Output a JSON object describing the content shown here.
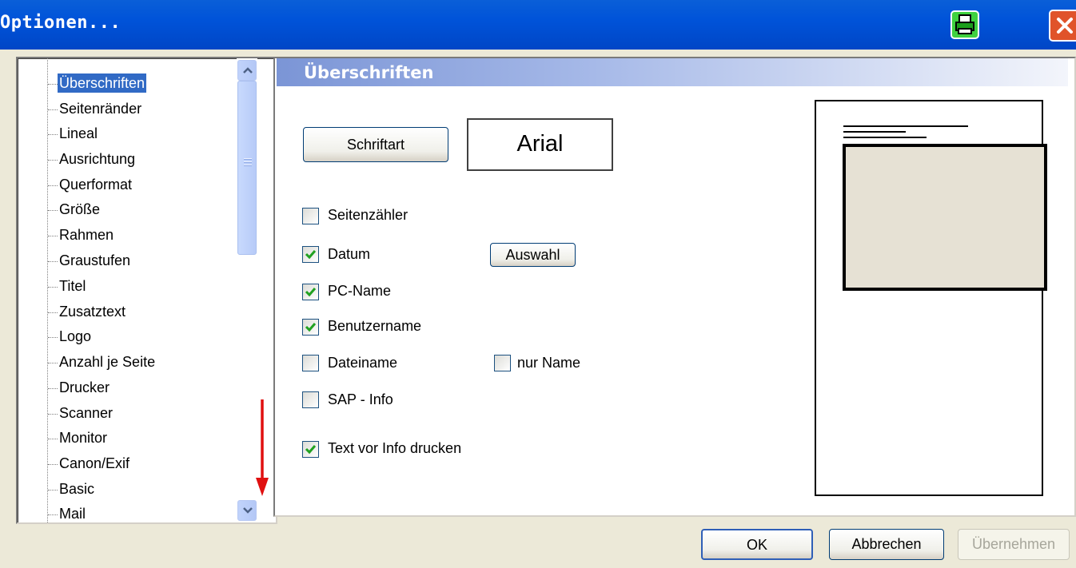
{
  "window": {
    "title": "Optionen...",
    "colors": {
      "titlebar": "#0053d9",
      "close": "#e0532a",
      "print_button": "#3fd13f"
    },
    "icons": {
      "print": "printer-icon",
      "close": "close-icon"
    }
  },
  "tree": {
    "selected": "Überschriften",
    "items": [
      {
        "label": "Überschriften"
      },
      {
        "label": "Seitenränder"
      },
      {
        "label": "Lineal"
      },
      {
        "label": "Ausrichtung"
      },
      {
        "label": "Querformat"
      },
      {
        "label": "Größe"
      },
      {
        "label": "Rahmen"
      },
      {
        "label": "Graustufen"
      },
      {
        "label": "Titel"
      },
      {
        "label": "Zusatztext"
      },
      {
        "label": "Logo"
      },
      {
        "label": "Anzahl je Seite"
      },
      {
        "label": "Drucker"
      },
      {
        "label": "Scanner"
      },
      {
        "label": "Monitor"
      },
      {
        "label": "Canon/Exif"
      },
      {
        "label": "Basic"
      },
      {
        "label": "Mail"
      }
    ]
  },
  "panel": {
    "title": "Überschriften",
    "font_button": "Schriftart",
    "font_name": "Arial",
    "select_button": "Auswahl",
    "options": {
      "seitenzaehler": {
        "label": "Seitenzähler",
        "checked": false
      },
      "datum": {
        "label": "Datum",
        "checked": true
      },
      "pc_name": {
        "label": "PC-Name",
        "checked": true
      },
      "benutzername": {
        "label": "Benutzername",
        "checked": true
      },
      "dateiname": {
        "label": "Dateiname",
        "checked": false
      },
      "nur_name": {
        "label": "nur Name",
        "checked": false
      },
      "sap_info": {
        "label": "SAP - Info",
        "checked": false
      },
      "text_vor_info": {
        "label": "Text vor Info drucken",
        "checked": true
      }
    }
  },
  "footer": {
    "ok": "OK",
    "cancel": "Abbrechen",
    "apply": "Übernehmen"
  }
}
